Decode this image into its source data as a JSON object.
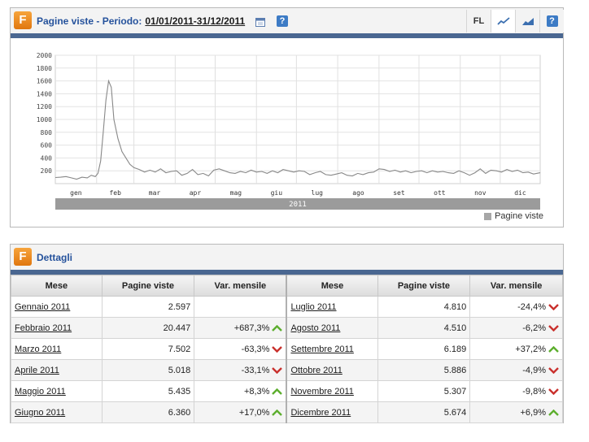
{
  "panel1": {
    "title": "Pagine viste - Periodo:",
    "period": "01/01/2011-31/12/2011",
    "toolbar": {
      "fl_label": "FL",
      "help_label": "?"
    },
    "legend": "Pagine viste",
    "year_label": "2011"
  },
  "panel2": {
    "title": "Dettagli",
    "headers": [
      "Mese",
      "Pagine viste",
      "Var. mensile",
      "Mese",
      "Pagine viste",
      "Var. mensile"
    ],
    "rows": [
      {
        "month": "Gennaio 2011",
        "views": "2.597",
        "var": "",
        "dir": "none",
        "month2": "Luglio 2011",
        "views2": "4.810",
        "var2": "-24,4%",
        "dir2": "down"
      },
      {
        "month": "Febbraio 2011",
        "views": "20.447",
        "var": "+687,3%",
        "dir": "up",
        "month2": "Agosto 2011",
        "views2": "4.510",
        "var2": "-6,2%",
        "dir2": "down"
      },
      {
        "month": "Marzo 2011",
        "views": "7.502",
        "var": "-63,3%",
        "dir": "down",
        "month2": "Settembre 2011",
        "views2": "6.189",
        "var2": "+37,2%",
        "dir2": "up"
      },
      {
        "month": "Aprile 2011",
        "views": "5.018",
        "var": "-33,1%",
        "dir": "down",
        "month2": "Ottobre 2011",
        "views2": "5.886",
        "var2": "-4,9%",
        "dir2": "down"
      },
      {
        "month": "Maggio 2011",
        "views": "5.435",
        "var": "+8,3%",
        "dir": "up",
        "month2": "Novembre 2011",
        "views2": "5.307",
        "var2": "-9,8%",
        "dir2": "down"
      },
      {
        "month": "Giugno 2011",
        "views": "6.360",
        "var": "+17,0%",
        "dir": "up",
        "month2": "Dicembre 2011",
        "views2": "5.674",
        "var2": "+6,9%",
        "dir2": "up"
      }
    ]
  },
  "colors": {
    "accent": "#4a6791",
    "title": "#25529c",
    "line": "#888888",
    "up": "#5cae2d",
    "down": "#c9302c",
    "icon": "#f08c1e"
  },
  "chart_data": {
    "type": "line",
    "title": "",
    "xlabel": "2011",
    "ylabel": "",
    "ylim": [
      0,
      2000
    ],
    "yticks": [
      200,
      400,
      600,
      800,
      1000,
      1200,
      1400,
      1600,
      1800,
      2000
    ],
    "categories": [
      "gen",
      "feb",
      "mar",
      "apr",
      "mag",
      "giu",
      "lug",
      "ago",
      "set",
      "ott",
      "nov",
      "dic"
    ],
    "series": [
      {
        "name": "Pagine viste",
        "x_unit": "day of year",
        "points": [
          [
            1,
            95
          ],
          [
            5,
            100
          ],
          [
            9,
            110
          ],
          [
            13,
            90
          ],
          [
            17,
            70
          ],
          [
            21,
            100
          ],
          [
            25,
            90
          ],
          [
            28,
            130
          ],
          [
            31,
            110
          ],
          [
            33,
            160
          ],
          [
            35,
            350
          ],
          [
            37,
            800
          ],
          [
            39,
            1300
          ],
          [
            41,
            1600
          ],
          [
            43,
            1500
          ],
          [
            45,
            1000
          ],
          [
            48,
            700
          ],
          [
            51,
            500
          ],
          [
            54,
            400
          ],
          [
            57,
            300
          ],
          [
            60,
            250
          ],
          [
            64,
            220
          ],
          [
            68,
            180
          ],
          [
            72,
            210
          ],
          [
            76,
            180
          ],
          [
            80,
            230
          ],
          [
            84,
            170
          ],
          [
            88,
            190
          ],
          [
            92,
            200
          ],
          [
            96,
            130
          ],
          [
            100,
            160
          ],
          [
            104,
            220
          ],
          [
            108,
            140
          ],
          [
            112,
            160
          ],
          [
            116,
            120
          ],
          [
            120,
            210
          ],
          [
            124,
            230
          ],
          [
            128,
            200
          ],
          [
            132,
            170
          ],
          [
            136,
            160
          ],
          [
            140,
            190
          ],
          [
            144,
            170
          ],
          [
            148,
            210
          ],
          [
            152,
            180
          ],
          [
            156,
            190
          ],
          [
            160,
            160
          ],
          [
            164,
            200
          ],
          [
            168,
            170
          ],
          [
            172,
            220
          ],
          [
            176,
            200
          ],
          [
            180,
            180
          ],
          [
            184,
            200
          ],
          [
            188,
            190
          ],
          [
            192,
            140
          ],
          [
            196,
            170
          ],
          [
            200,
            190
          ],
          [
            204,
            140
          ],
          [
            208,
            130
          ],
          [
            212,
            150
          ],
          [
            216,
            170
          ],
          [
            220,
            130
          ],
          [
            224,
            120
          ],
          [
            228,
            160
          ],
          [
            232,
            140
          ],
          [
            236,
            170
          ],
          [
            240,
            180
          ],
          [
            244,
            230
          ],
          [
            248,
            220
          ],
          [
            252,
            190
          ],
          [
            256,
            210
          ],
          [
            260,
            180
          ],
          [
            264,
            200
          ],
          [
            268,
            170
          ],
          [
            272,
            190
          ],
          [
            276,
            200
          ],
          [
            280,
            170
          ],
          [
            284,
            200
          ],
          [
            288,
            180
          ],
          [
            292,
            190
          ],
          [
            296,
            170
          ],
          [
            300,
            160
          ],
          [
            304,
            200
          ],
          [
            308,
            170
          ],
          [
            312,
            130
          ],
          [
            316,
            170
          ],
          [
            320,
            230
          ],
          [
            324,
            160
          ],
          [
            328,
            210
          ],
          [
            332,
            200
          ],
          [
            336,
            180
          ],
          [
            340,
            220
          ],
          [
            344,
            190
          ],
          [
            348,
            210
          ],
          [
            352,
            170
          ],
          [
            356,
            180
          ],
          [
            360,
            150
          ],
          [
            365,
            170
          ]
        ]
      }
    ]
  }
}
